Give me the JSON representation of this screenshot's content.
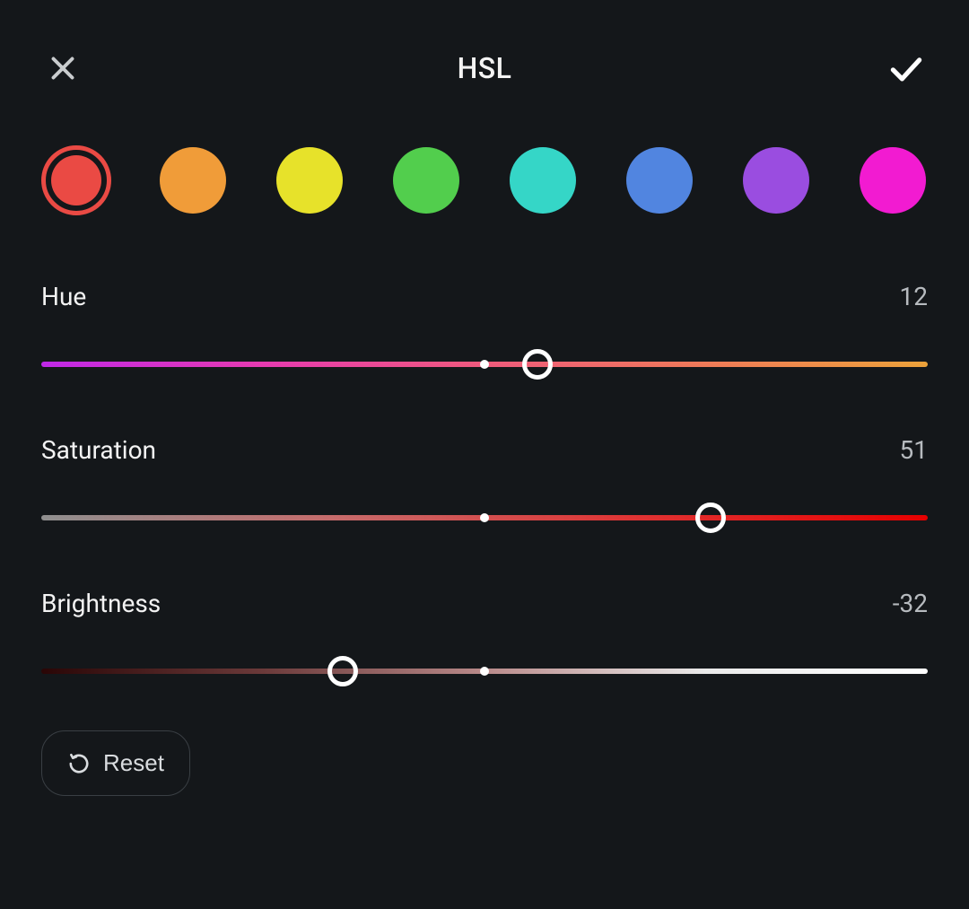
{
  "header": {
    "title": "HSL",
    "close_icon": "close-icon",
    "confirm_icon": "check-icon"
  },
  "swatches": {
    "selected_index": 0,
    "items": [
      {
        "name": "red",
        "color": "#ea4a44"
      },
      {
        "name": "orange",
        "color": "#f09c39"
      },
      {
        "name": "yellow",
        "color": "#e7e22a"
      },
      {
        "name": "green",
        "color": "#52ce4d"
      },
      {
        "name": "cyan",
        "color": "#35d6c7"
      },
      {
        "name": "blue",
        "color": "#5185e0"
      },
      {
        "name": "purple",
        "color": "#9a4de0"
      },
      {
        "name": "magenta",
        "color": "#f21bd1"
      }
    ]
  },
  "sliders": {
    "range": {
      "min": -100,
      "max": 100
    },
    "hue": {
      "label": "Hue",
      "value": 12
    },
    "saturation": {
      "label": "Saturation",
      "value": 51
    },
    "brightness": {
      "label": "Brightness",
      "value": -32
    }
  },
  "reset": {
    "label": "Reset",
    "icon": "undo-icon"
  }
}
